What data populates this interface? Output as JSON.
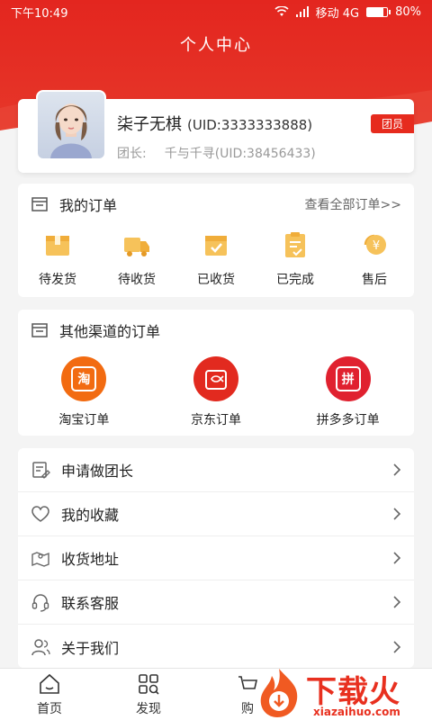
{
  "status_bar": {
    "time": "下午10:49",
    "carrier": "移动 4G",
    "battery": "80%",
    "battery_level": 0.8
  },
  "header": {
    "title": "个人中心"
  },
  "profile": {
    "name": "柒子无棋",
    "uid": "(UID:3333333888)",
    "leader_label": "团长:",
    "leader_name": "千与千寻",
    "leader_uid": "(UID:38456433)",
    "badge": "团员"
  },
  "my_orders": {
    "title": "我的订单",
    "view_all": "查看全部订单>>",
    "items": [
      {
        "label": "待发货",
        "icon": "box-icon"
      },
      {
        "label": "待收货",
        "icon": "truck-icon"
      },
      {
        "label": "已收货",
        "icon": "received-icon"
      },
      {
        "label": "已完成",
        "icon": "completed-icon"
      },
      {
        "label": "售后",
        "icon": "after-sale-icon"
      }
    ]
  },
  "other_orders": {
    "title": "其他渠道的订单",
    "items": [
      {
        "label": "淘宝订单",
        "glyph": "淘",
        "color": "#f26b11"
      },
      {
        "label": "京东订单",
        "glyph": "",
        "color": "#e22a1f"
      },
      {
        "label": "拼多多订单",
        "glyph": "拼",
        "color": "#e0212f"
      }
    ]
  },
  "menu": [
    {
      "label": "申请做团长",
      "icon": "apply-icon"
    },
    {
      "label": "我的收藏",
      "icon": "heart-icon"
    },
    {
      "label": "收货地址",
      "icon": "map-icon"
    },
    {
      "label": "联系客服",
      "icon": "headset-icon"
    },
    {
      "label": "关于我们",
      "icon": "users-icon"
    }
  ],
  "tabbar": [
    {
      "label": "首页",
      "icon": "home-icon"
    },
    {
      "label": "发现",
      "icon": "discover-icon"
    },
    {
      "label": "购"
    }
  ],
  "watermark": {
    "text": "下载火",
    "sub": "xiazaihuo.com"
  }
}
